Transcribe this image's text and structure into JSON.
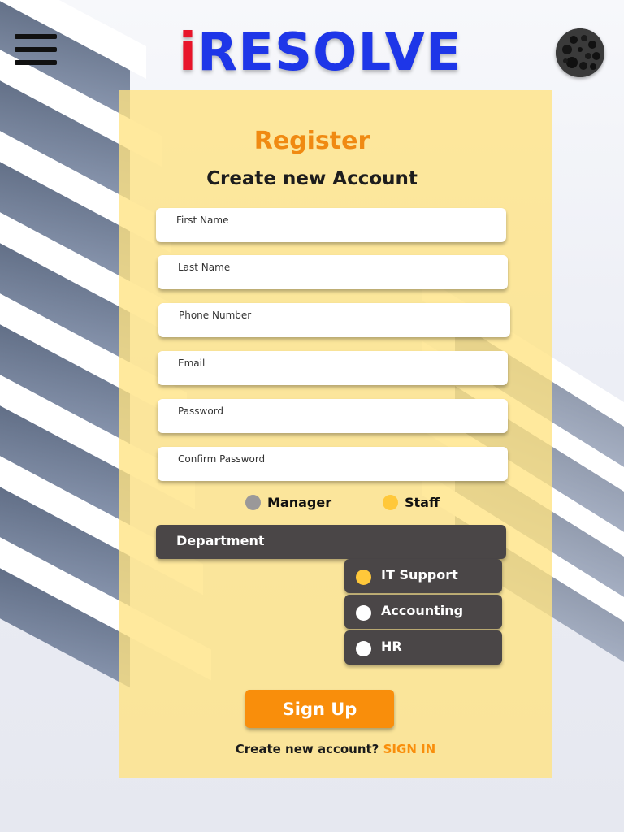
{
  "header": {
    "logo_first": "i",
    "logo_rest": "RESOLVE",
    "menu_icon": "hamburger-menu-icon",
    "avatar_icon": "user-avatar-icon"
  },
  "form": {
    "title": "Register",
    "subtitle": "Create new Account",
    "fields": [
      {
        "label": "First Name",
        "value": ""
      },
      {
        "label": "Last Name",
        "value": ""
      },
      {
        "label": "Phone Number",
        "value": ""
      },
      {
        "label": "Email",
        "value": ""
      },
      {
        "label": "Password",
        "value": ""
      },
      {
        "label": "Confirm Password",
        "value": ""
      }
    ],
    "roles": [
      {
        "label": "Manager",
        "selected": false
      },
      {
        "label": "Staff",
        "selected": true
      }
    ],
    "department": {
      "label": "Department",
      "options": [
        {
          "label": "IT Support",
          "selected": true
        },
        {
          "label": "Accounting",
          "selected": false
        },
        {
          "label": "HR",
          "selected": false
        }
      ]
    },
    "submit_label": "Sign Up",
    "footer_text": "Create new account?",
    "footer_link": "SIGN IN"
  },
  "colors": {
    "logo_i": "#e8142a",
    "logo_text": "#1e36e8",
    "card_bg": "#ffe382",
    "accent_orange": "#f98e0b",
    "title_orange": "#f08a12",
    "dark_panel": "#4a4647",
    "radio_selected": "#ffc83a",
    "radio_unselected_light": "#ffffff",
    "radio_unselected_grey": "#9a9899"
  }
}
